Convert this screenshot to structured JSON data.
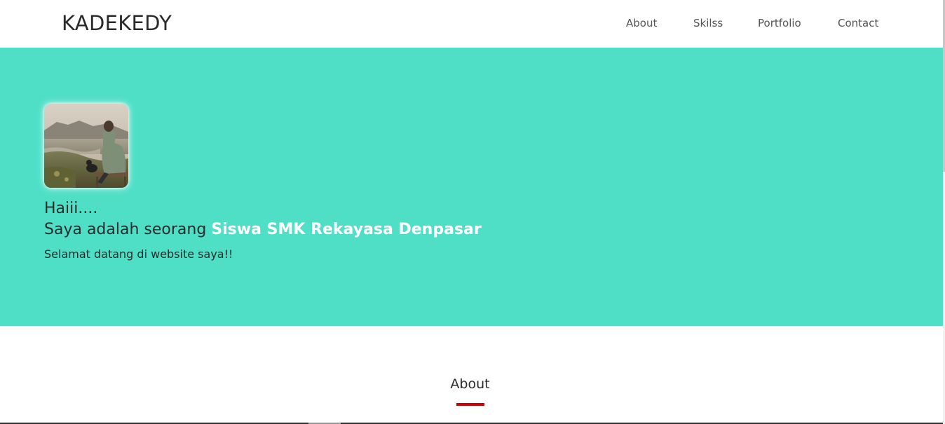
{
  "navbar": {
    "brand": "KADEKEDY",
    "links": [
      "About",
      "Skilss",
      "Portfolio",
      "Contact"
    ]
  },
  "hero": {
    "greeting": "Haiii....",
    "line_prefix": "Saya adalah seorang ",
    "line_highlight": "Siswa SMK Rekayasa Denpasar",
    "subtitle": "Selamat datang di website saya!!",
    "background_color": "#4fdfc7"
  },
  "about": {
    "title": "About",
    "underline_color": "#cc0000"
  }
}
